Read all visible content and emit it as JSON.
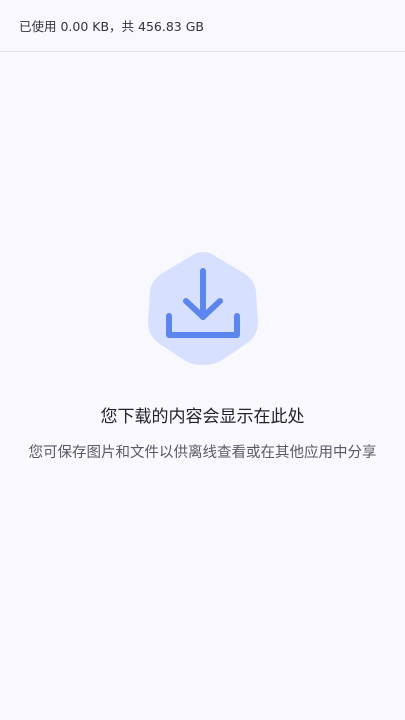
{
  "storage": {
    "text": "已使用 0.00 KB，共 456.83 GB"
  },
  "empty_state": {
    "icon": "download-icon",
    "title": "您下载的内容会显示在此处",
    "description": "您可保存图片和文件以供离线查看或在其他应用中分享"
  },
  "colors": {
    "background": "#f8f8fe",
    "badge_fill": "#d7e0ff",
    "icon_stroke": "#5b85ef",
    "divider": "#e4e4ea"
  }
}
